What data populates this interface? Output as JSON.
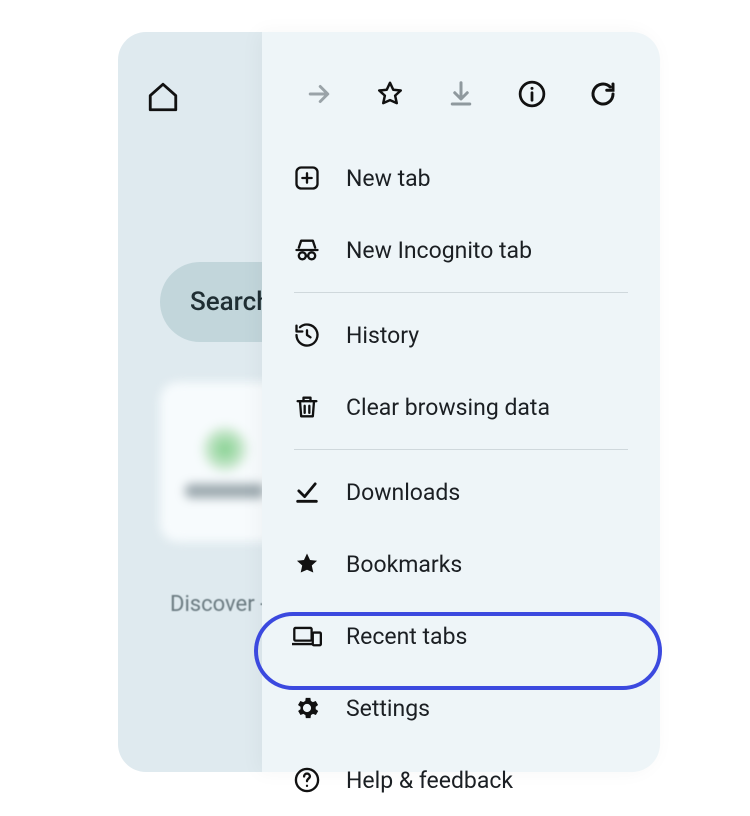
{
  "background": {
    "search_label": "Search",
    "discover_label": "Discover - "
  },
  "menu": {
    "items": {
      "new_tab": "New tab",
      "incognito": "New Incognito tab",
      "history": "History",
      "clear_data": "Clear browsing data",
      "downloads": "Downloads",
      "bookmarks": "Bookmarks",
      "recent_tabs": "Recent tabs",
      "settings": "Settings",
      "help": "Help & feedback"
    }
  }
}
